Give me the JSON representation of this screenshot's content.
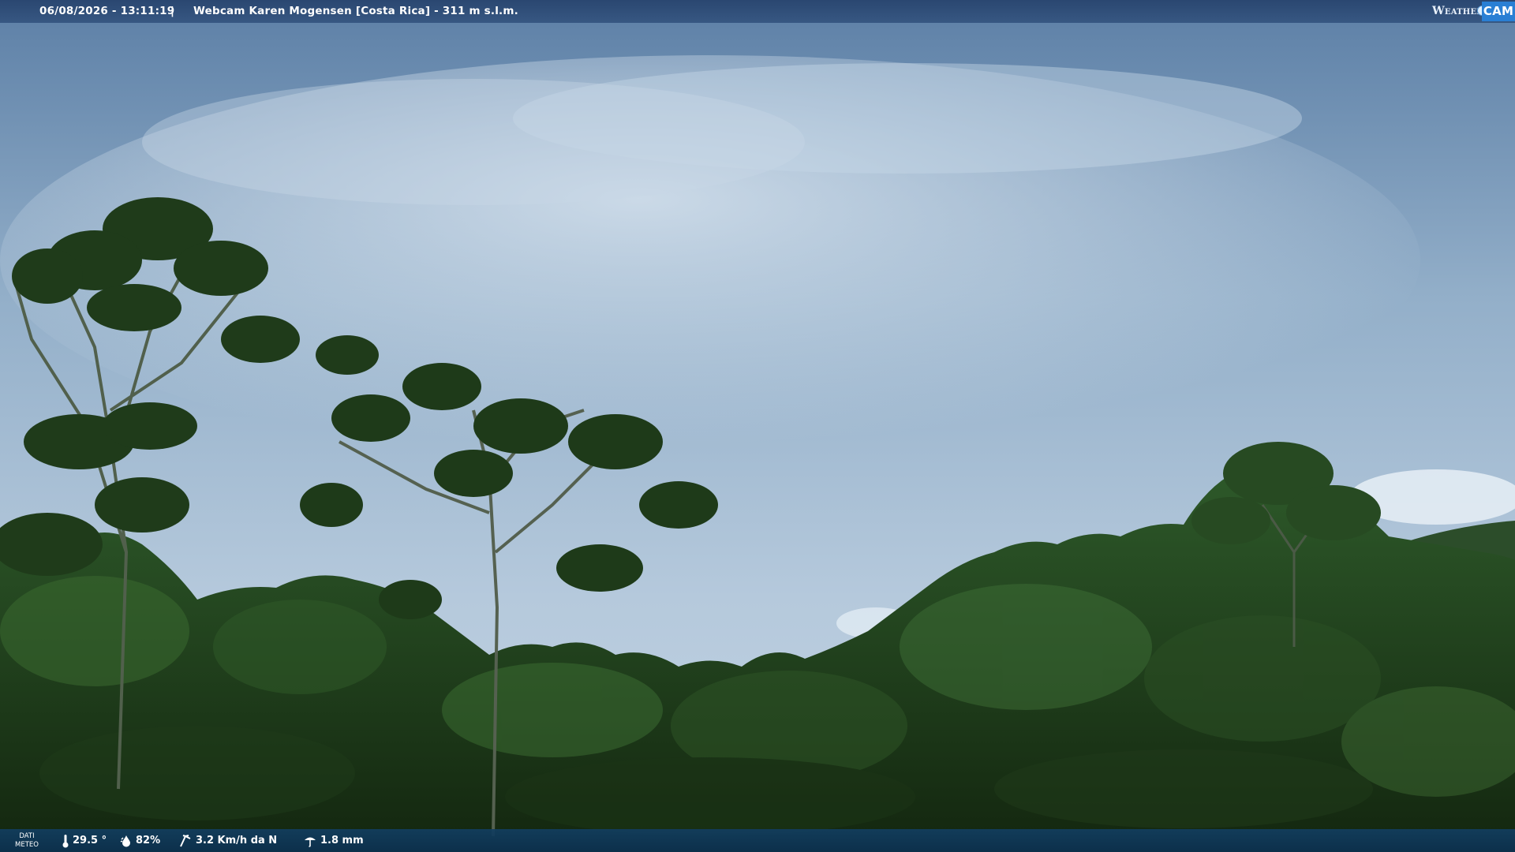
{
  "header": {
    "datetime": "06/08/2026 - 13:11:19",
    "separator": "|",
    "title": "Webcam Karen Mogensen [Costa Rica] - 311 m s.l.m."
  },
  "logo": {
    "weather_text": "Weather",
    "cam_text": "CAM"
  },
  "weather_bar": {
    "label_line1": "DATI",
    "label_line2": "METEO",
    "temperature": "29.5 °",
    "humidity": "82%",
    "wind": "3.2 Km/h da N",
    "rain": "1.8 mm"
  },
  "icons": {
    "temperature": "thermometer-icon",
    "humidity": "humidity-drop-icon",
    "wind": "wind-icon",
    "rain": "rain-icon"
  },
  "colors": {
    "header_bar": "#2e5282",
    "footer_bar": "#123e60",
    "logo_blue": "#2a7fd4",
    "sky": "#8eaac6",
    "foliage": "#243f1c"
  }
}
